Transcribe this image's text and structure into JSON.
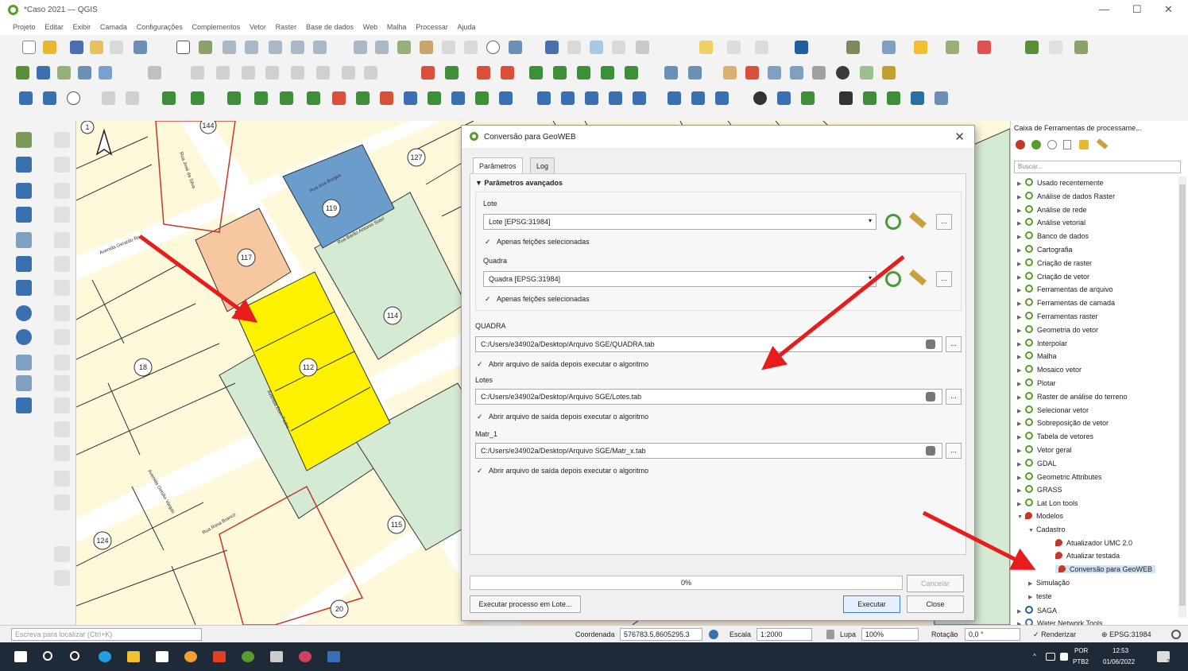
{
  "window": {
    "title": "*Caso 2021 — QGIS",
    "min": "—",
    "max": "☐",
    "close": "✕"
  },
  "menu": [
    "Projeto",
    "Editar",
    "Exibir",
    "Camada",
    "Configurações",
    "Complementos",
    "Vetor",
    "Raster",
    "Base de dados",
    "Web",
    "Malha",
    "Processar",
    "Ajuda"
  ],
  "map": {
    "parcel_labels": [
      "144",
      "127",
      "119",
      "117",
      "114",
      "112",
      "18",
      "115",
      "124",
      "20",
      "1"
    ],
    "street_labels": [
      "Avenida Gerardo Ra...",
      "Rua Barão Antonio Sotel",
      "Rua Ana Borges",
      "Avenida Dom Pedro",
      "Avenida Getúlio Vargas",
      "Rua Rosa Branco",
      "Rua José da Silva"
    ],
    "colors": {
      "base": "#fff9dc",
      "green": "#d5ead3",
      "blue": "#6a9ccc",
      "orange": "#f7c8a0",
      "yellow": "#fff200",
      "road": "#ffffff"
    }
  },
  "dialog": {
    "title": "Conversão para GeoWEB",
    "close": "✕",
    "tabs": [
      "Parâmetros",
      "Log"
    ],
    "section_header": "Parâmetros avançados",
    "lote_label": "Lote",
    "lote_value": "Lote [EPSG:31984]",
    "lote_check": "Apenas feições selecionadas",
    "quadra_label": "Quadra",
    "quadra_value": "Quadra [EPSG:31984]",
    "quadra_check": "Apenas feições selecionadas",
    "out_quadra_label": "QUADRA",
    "out_quadra_path": "C:/Users/e34902a/Desktop/Arquivo SGE/QUADRA.tab",
    "out_quadra_check": "Abrir arquivo de saída depois executar o algoritmo",
    "out_lotes_label": "Lotes",
    "out_lotes_path": "C:/Users/e34902a/Desktop/Arquivo SGE/Lotes.tab",
    "out_lotes_check": "Abrir arquivo de saída depois executar o algoritmo",
    "out_matr_label": "Matr_1",
    "out_matr_path": "C:/Users/e34902a/Desktop/Arquivo SGE/Matr_x.tab",
    "out_matr_check": "Abrir arquivo de saída depois executar o algoritmo",
    "progress_text": "0%",
    "progress": 0,
    "cancel": "Cancelar",
    "batch": "Executar processo em Lote...",
    "run": "Executar",
    "close_btn": "Close",
    "browse": "...",
    "check": "✓"
  },
  "toolbox": {
    "title": "Caixa de Ferramentas de processame...",
    "search_placeholder": "Buscar...",
    "items": [
      "Usado recentemente",
      "Análise de dados Raster",
      "Análise de rede",
      "Análise vetorial",
      "Banco de dados",
      "Cartografia",
      "Criação de raster",
      "Criação de vetor",
      "Ferramentas de arquivo",
      "Ferramentas de camada",
      "Ferramentas raster",
      "Geometria do vetor",
      "Interpolar",
      "Malha",
      "Mosaico vetor",
      "Plotar",
      "Raster de análise do terreno",
      "Selecionar vetor",
      "Sobreposição de vetor",
      "Tabela de vetores",
      "Vetor geral",
      "GDAL",
      "Geometric Attributes",
      "GRASS",
      "Lat Lon tools",
      "Modelos"
    ],
    "models_group": "Cadastro",
    "models": [
      "Atualizador UMC 2.0",
      "Atualizar testada",
      "Conversão para GeoWEB"
    ],
    "tail": [
      "Simulação",
      "teste",
      "SAGA",
      "Water Network Tools"
    ]
  },
  "statusbar": {
    "locator_placeholder": "Escreva para localizar (Ctrl+K)",
    "coord_label": "Coordenada",
    "coord_value": "576783.5,8605295.3",
    "scale_label": "Escala",
    "scale_value": "1:2000",
    "lupa_label": "Lupa",
    "lupa_value": "100%",
    "rotation_label": "Rotação",
    "rotation_value": "0,0 °",
    "render_label": "Renderizar",
    "epsg": "EPSG:31984"
  },
  "taskbar": {
    "lang1": "POR",
    "lang2": "PTB2",
    "time": "12:53",
    "date": "01/06/2022",
    "notif": "22"
  }
}
